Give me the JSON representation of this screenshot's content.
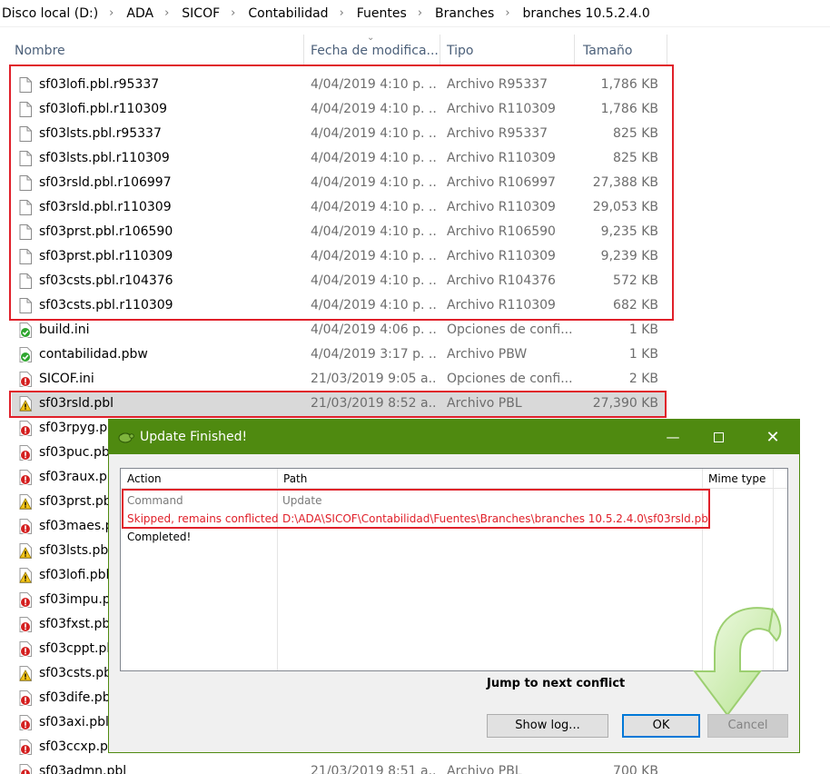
{
  "breadcrumb": [
    "Disco local (D:)",
    "ADA",
    "SICOF",
    "Contabilidad",
    "Fuentes",
    "Branches",
    "branches 10.5.2.4.0"
  ],
  "columns": {
    "name": "Nombre",
    "date": "Fecha de modifica...",
    "type": "Tipo",
    "size": "Tamaño"
  },
  "files": [
    {
      "name": "sf03lofi.pbl.r95337",
      "date": "4/04/2019 4:10 p. ...",
      "type": "Archivo R95337",
      "size": "1,786 KB",
      "icon": "document-icon"
    },
    {
      "name": "sf03lofi.pbl.r110309",
      "date": "4/04/2019 4:10 p. ...",
      "type": "Archivo R110309",
      "size": "1,786 KB",
      "icon": "document-icon"
    },
    {
      "name": "sf03lsts.pbl.r95337",
      "date": "4/04/2019 4:10 p. ...",
      "type": "Archivo R95337",
      "size": "825 KB",
      "icon": "document-icon"
    },
    {
      "name": "sf03lsts.pbl.r110309",
      "date": "4/04/2019 4:10 p. ...",
      "type": "Archivo R110309",
      "size": "825 KB",
      "icon": "document-icon"
    },
    {
      "name": "sf03rsld.pbl.r106997",
      "date": "4/04/2019 4:10 p. ...",
      "type": "Archivo R106997",
      "size": "27,388 KB",
      "icon": "document-icon"
    },
    {
      "name": "sf03rsld.pbl.r110309",
      "date": "4/04/2019 4:10 p. ...",
      "type": "Archivo R110309",
      "size": "29,053 KB",
      "icon": "document-icon"
    },
    {
      "name": "sf03prst.pbl.r106590",
      "date": "4/04/2019 4:10 p. ...",
      "type": "Archivo R106590",
      "size": "9,235 KB",
      "icon": "document-icon"
    },
    {
      "name": "sf03prst.pbl.r110309",
      "date": "4/04/2019 4:10 p. ...",
      "type": "Archivo R110309",
      "size": "9,239 KB",
      "icon": "document-icon"
    },
    {
      "name": "sf03csts.pbl.r104376",
      "date": "4/04/2019 4:10 p. ...",
      "type": "Archivo R104376",
      "size": "572 KB",
      "icon": "document-icon"
    },
    {
      "name": "sf03csts.pbl.r110309",
      "date": "4/04/2019 4:10 p. ...",
      "type": "Archivo R110309",
      "size": "682 KB",
      "icon": "document-icon"
    },
    {
      "name": "build.ini",
      "date": "4/04/2019 4:06 p. ...",
      "type": "Opciones de confi...",
      "size": "1 KB",
      "icon": "svn-ok-icon"
    },
    {
      "name": "contabilidad.pbw",
      "date": "4/04/2019 3:17 p. ...",
      "type": "Archivo PBW",
      "size": "1 KB",
      "icon": "svn-ok-icon"
    },
    {
      "name": "SICOF.ini",
      "date": "21/03/2019 9:05 a....",
      "type": "Opciones de confi...",
      "size": "2 KB",
      "icon": "svn-modified-icon"
    },
    {
      "name": "sf03rsld.pbl",
      "date": "21/03/2019 8:52 a....",
      "type": "Archivo PBL",
      "size": "27,390 KB",
      "icon": "svn-conflict-icon"
    },
    {
      "name": "sf03rpyg.pbl",
      "date": "",
      "type": "",
      "size": "",
      "icon": "svn-modified-icon"
    },
    {
      "name": "sf03puc.pbl",
      "date": "",
      "type": "",
      "size": "",
      "icon": "svn-modified-icon"
    },
    {
      "name": "sf03raux.pbl",
      "date": "",
      "type": "",
      "size": "",
      "icon": "svn-modified-icon"
    },
    {
      "name": "sf03prst.pbl",
      "date": "",
      "type": "",
      "size": "",
      "icon": "svn-conflict-icon"
    },
    {
      "name": "sf03maes.pbl",
      "date": "",
      "type": "",
      "size": "",
      "icon": "svn-modified-icon"
    },
    {
      "name": "sf03lsts.pbl",
      "date": "",
      "type": "",
      "size": "",
      "icon": "svn-conflict-icon"
    },
    {
      "name": "sf03lofi.pbl",
      "date": "",
      "type": "",
      "size": "",
      "icon": "svn-conflict-icon"
    },
    {
      "name": "sf03impu.pbl",
      "date": "",
      "type": "",
      "size": "",
      "icon": "svn-modified-icon"
    },
    {
      "name": "sf03fxst.pbl",
      "date": "",
      "type": "",
      "size": "",
      "icon": "svn-modified-icon"
    },
    {
      "name": "sf03cppt.pbl",
      "date": "",
      "type": "",
      "size": "",
      "icon": "svn-modified-icon"
    },
    {
      "name": "sf03csts.pbl",
      "date": "",
      "type": "",
      "size": "",
      "icon": "svn-conflict-icon"
    },
    {
      "name": "sf03dife.pbl",
      "date": "",
      "type": "",
      "size": "",
      "icon": "svn-modified-icon"
    },
    {
      "name": "sf03axi.pbl",
      "date": "",
      "type": "",
      "size": "",
      "icon": "svn-modified-icon"
    },
    {
      "name": "sf03ccxp.pbl",
      "date": "",
      "type": "",
      "size": "",
      "icon": "svn-modified-icon"
    },
    {
      "name": "sf03admn.pbl",
      "date": "21/03/2019 8:51 a....",
      "type": "Archivo PBL",
      "size": "700 KB",
      "icon": "svn-modified-icon"
    }
  ],
  "selected_index": 13,
  "dialog": {
    "title": "Update Finished!",
    "columns": {
      "action": "Action",
      "path": "Path",
      "mime": "Mime type"
    },
    "rows": [
      {
        "action": "Command",
        "path": "Update",
        "style": "grey"
      },
      {
        "action": "Skipped, remains conflicted",
        "path": "D:\\ADA\\SICOF\\Contabilidad\\Fuentes\\Branches\\branches 10.5.2.4.0\\sf03rsld.pbl",
        "style": "red"
      },
      {
        "action": "Completed!",
        "path": "",
        "style": "black"
      }
    ],
    "jump_label": "Jump to next conflict",
    "show_log_label": "Show log...",
    "ok_label": "OK",
    "cancel_label": "Cancel"
  },
  "colors": {
    "accent_green": "#4f8a10",
    "highlight_red": "#e0202a",
    "selected_row": "#d9d9d9"
  }
}
